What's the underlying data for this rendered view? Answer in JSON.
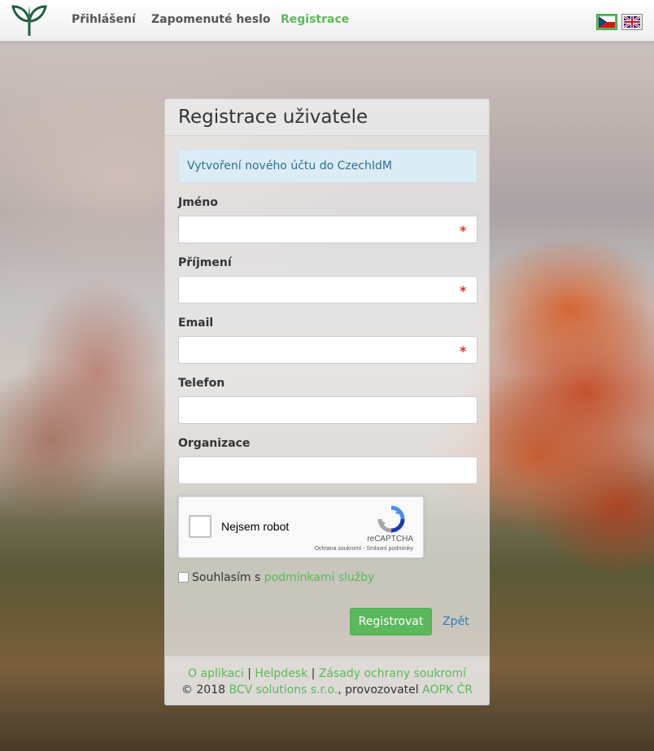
{
  "navbar": {
    "links": {
      "login": "Přihlášení",
      "forgot_password": "Zapomenuté heslo",
      "registration": "Registrace"
    },
    "active_link": "registration",
    "accent_color": "#5cb85c",
    "languages": [
      "cs",
      "en"
    ],
    "active_language": "cs"
  },
  "panel": {
    "title": "Registrace uživatele",
    "info_alert": "Vytvoření nového účtu do CzechIdM",
    "fields": {
      "first_name": {
        "label": "Jméno",
        "value": "",
        "required": true
      },
      "last_name": {
        "label": "Příjmení",
        "value": "",
        "required": true
      },
      "email": {
        "label": "Email",
        "value": "",
        "required": true
      },
      "phone": {
        "label": "Telefon",
        "value": "",
        "required": false
      },
      "organization": {
        "label": "Organizace",
        "value": "",
        "required": false
      }
    },
    "required_marker": "*",
    "captcha": {
      "label": "Nejsem robot",
      "brand": "reCAPTCHA",
      "terms": "Ochrana soukromí - Smluvní podmínky",
      "checked": false
    },
    "agree": {
      "prefix": "Souhlasím s ",
      "link": "podmínkami služby",
      "checked": false
    },
    "buttons": {
      "register": "Registrovat",
      "back": "Zpět"
    },
    "footer": {
      "about": "O aplikaci",
      "helpdesk": "Helpdesk",
      "privacy": "Zásady ochrany soukromí",
      "separator": "|",
      "copyright_prefix": "© 2018 ",
      "vendor": "BCV solutions s.r.o.",
      "operator_prefix": ", provozovatel ",
      "operator": "AOPK ČR"
    }
  }
}
